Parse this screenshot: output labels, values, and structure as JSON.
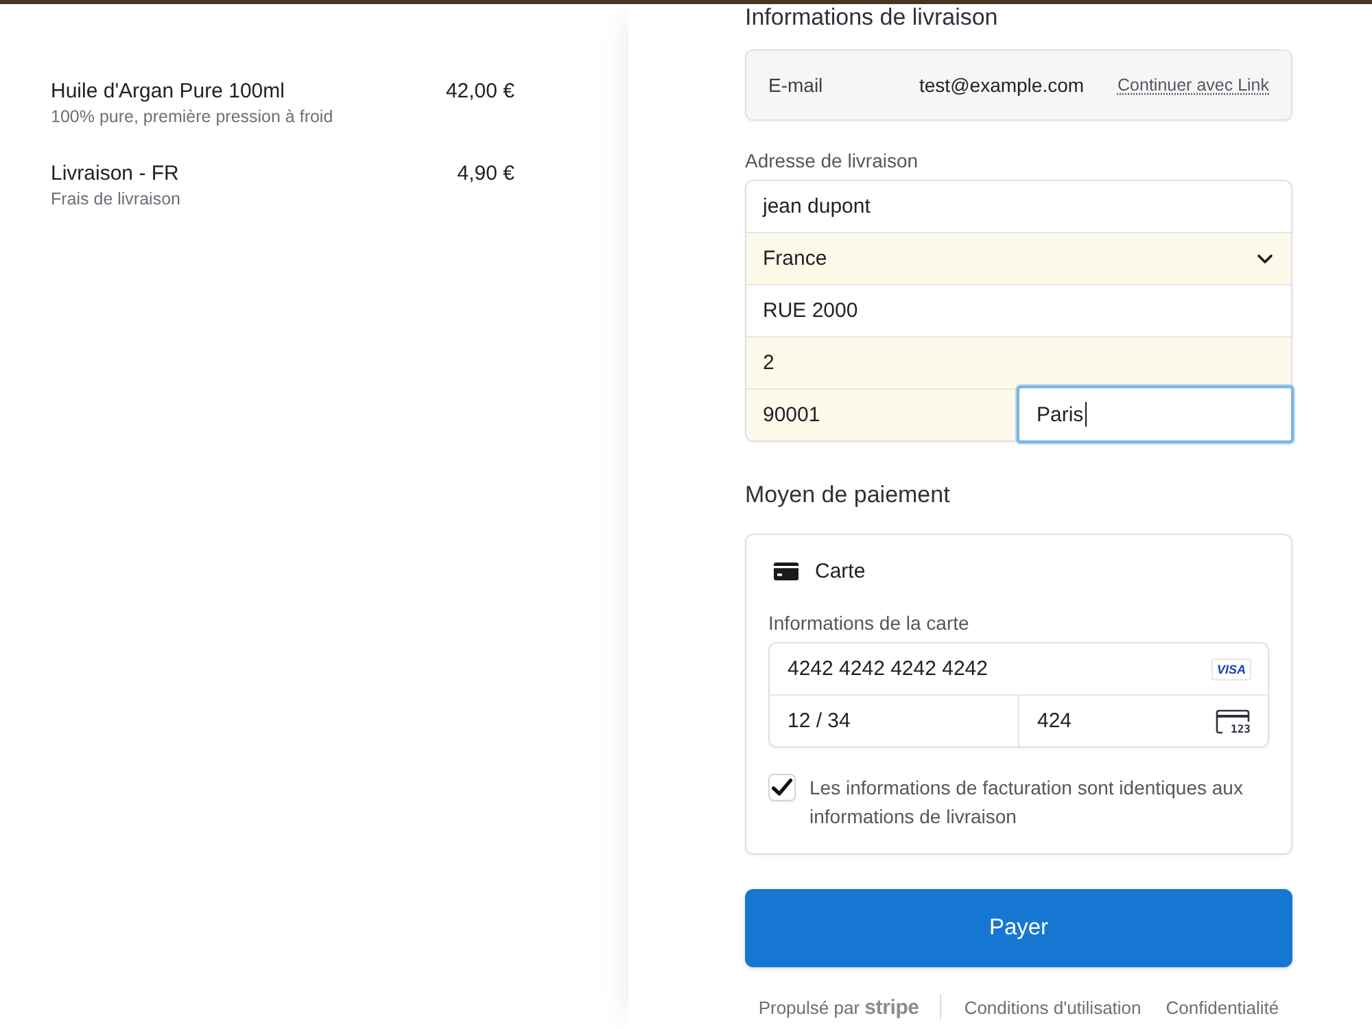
{
  "order_summary": {
    "items": [
      {
        "name": "Huile d'Argan Pure 100ml",
        "description": "100% pure, première pression à froid",
        "price": "42,00 €"
      },
      {
        "name": "Livraison - FR",
        "description": "Frais de livraison",
        "price": "4,90 €"
      }
    ]
  },
  "shipping": {
    "title": "Informations de livraison",
    "email": {
      "label": "E-mail",
      "value": "test@example.com",
      "link": "Continuer avec Link"
    },
    "address_label": "Adresse de livraison",
    "address_rows": [
      {
        "fields": [
          {
            "kind": "text",
            "value": "jean dupont",
            "autofilled": false,
            "focused": false
          }
        ]
      },
      {
        "fields": [
          {
            "kind": "select",
            "value": "France",
            "autofilled": true,
            "focused": false
          }
        ]
      },
      {
        "fields": [
          {
            "kind": "text",
            "value": "RUE 2000",
            "autofilled": false,
            "focused": false
          }
        ]
      },
      {
        "fields": [
          {
            "kind": "text",
            "value": "2",
            "autofilled": true,
            "focused": false
          }
        ]
      },
      {
        "fields": [
          {
            "kind": "text",
            "value": "90001",
            "autofilled": true,
            "focused": false
          },
          {
            "kind": "text",
            "value": "Paris",
            "autofilled": false,
            "focused": true
          }
        ]
      }
    ]
  },
  "payment": {
    "title": "Moyen de paiement",
    "method": "Carte",
    "card_label": "Informations de la carte",
    "card_number": "4242 4242 4242 4242",
    "brand_badge": "VISA",
    "expiry": "12 / 34",
    "cvc": "424",
    "cvc_icon_digits": "123",
    "billing_same": {
      "label": "Les informations de facturation sont identiques aux informations de livraison",
      "checked": true
    }
  },
  "pay_button": "Payer",
  "footer": {
    "powered_by": "Propulsé par **stripe**",
    "links": [
      "Conditions d'utilisation",
      "Confidentialité"
    ]
  }
}
